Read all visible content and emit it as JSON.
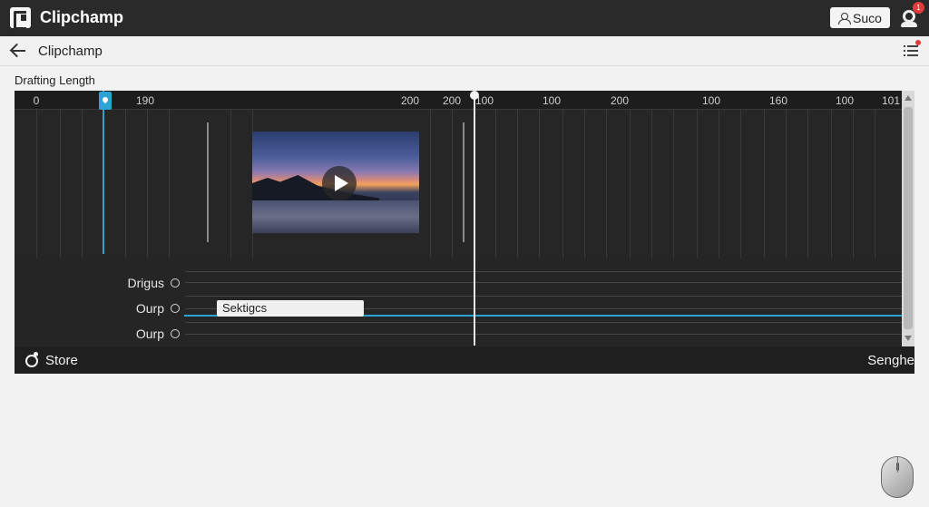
{
  "app": {
    "title": "Clipchamp",
    "login_label": "Suco",
    "notification_count": "1"
  },
  "subheader": {
    "title": "Clipchamp"
  },
  "section": {
    "label": "Drafting Length"
  },
  "ruler": {
    "ticks": [
      "0",
      "190",
      "200",
      "200",
      "100",
      "100",
      "200",
      "100",
      "160",
      "100",
      "101"
    ]
  },
  "tracks": [
    {
      "label": "Drigus"
    },
    {
      "label": "Ourp"
    },
    {
      "label": "Ourp"
    }
  ],
  "settings_pill": {
    "label": "Sektigcs"
  },
  "footer": {
    "store_label": "Store",
    "right_label": "Senghe"
  },
  "colors": {
    "accent": "#2ba3d4",
    "panel": "#252525",
    "topbar": "#2a2a2a",
    "badge": "#e23b3b"
  },
  "icons": [
    "app-logo-icon",
    "user-icon",
    "notification-icon",
    "back-arrow-icon",
    "list-menu-icon",
    "play-icon",
    "marker-icon",
    "store-icon",
    "mouse-icon"
  ]
}
